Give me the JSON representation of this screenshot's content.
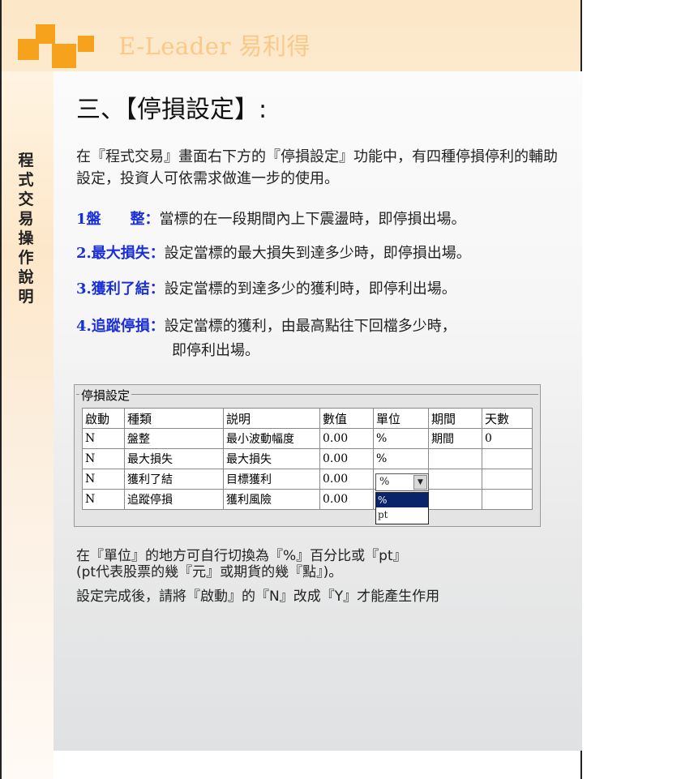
{
  "brand": {
    "name": "E-Leader 易利得",
    "accent_color": "#f7a21c"
  },
  "sidebar": {
    "label_chars": [
      "程",
      "式",
      "交",
      "易",
      "操",
      "作",
      "說",
      "明"
    ]
  },
  "section": {
    "title": "三、【停損設定】:"
  },
  "intro": {
    "text": "在『程式交易』畫面右下方的『停損設定』功能中，有四種停損停利的輔助設定，投資人可依需求做進一步的使用。"
  },
  "items": [
    {
      "label": "1盤　　整：",
      "text": "當標的在一段期間內上下震盪時，即停損出場。"
    },
    {
      "label": "2.最大損失：",
      "text": "設定當標的最大損失到達多少時，即停損出場。"
    },
    {
      "label": "3.獲利了結：",
      "text": "設定當標的到達多少的獲利時，即停利出場。"
    },
    {
      "label": "4.追蹤停損：",
      "text": "設定當標的獲利，由最高點往下回檔多少時，",
      "text2": "即停利出場。"
    }
  ],
  "grid": {
    "legend": "停損設定",
    "columns": [
      "啟動",
      "種類",
      "説明",
      "數值",
      "單位",
      "期間",
      "天數"
    ],
    "rows": [
      [
        "N",
        "盤整",
        "最小波動幅度",
        "0.00",
        "%",
        "期間",
        "0"
      ],
      [
        "N",
        "最大損失",
        "最大損失",
        "0.00",
        "%",
        "",
        ""
      ],
      [
        "N",
        "獲利了結",
        "目標獲利",
        "0.00",
        "",
        "",
        ""
      ],
      [
        "N",
        "追蹤停損",
        "獲利風險",
        "0.00",
        "",
        "",
        ""
      ]
    ],
    "dropdown": {
      "value": "%",
      "options": [
        "%",
        "pt"
      ],
      "selected": "%"
    }
  },
  "notes": {
    "line1": "在『單位』的地方可自行切換為『%』百分比或『pt』",
    "line2": "(pt代表股票的幾『元』或期貨的幾『點』)。",
    "line3": "設定完成後，請將『啟動』的『N』改成『Y』才能產生作用"
  }
}
